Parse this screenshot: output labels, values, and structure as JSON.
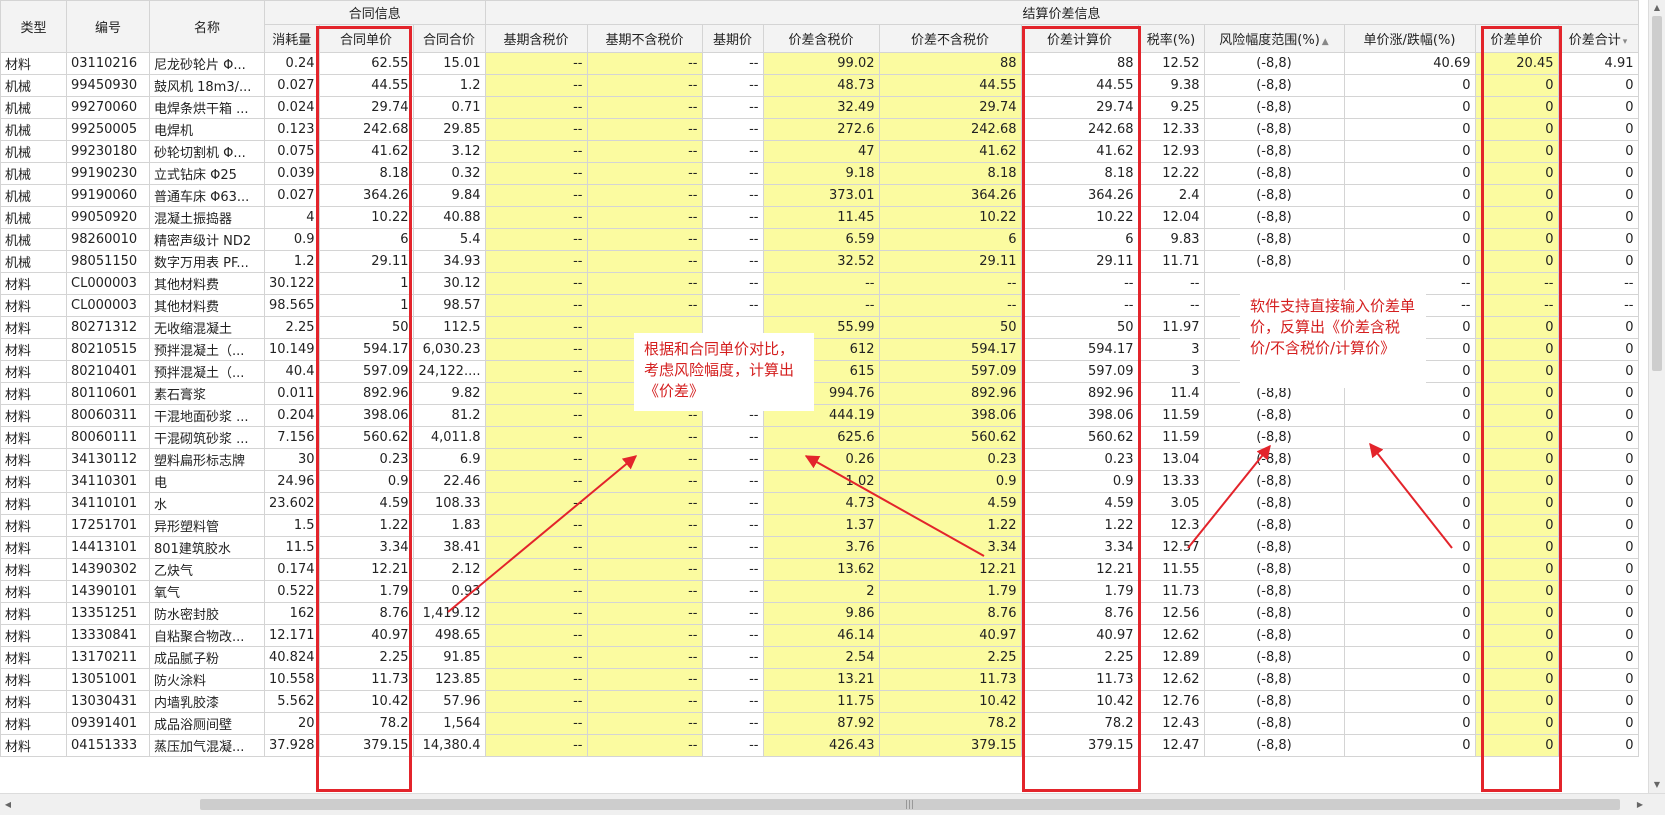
{
  "groups": {
    "contract": "合同信息",
    "settle": "结算价差信息"
  },
  "columns": [
    "类型",
    "编号",
    "名称",
    "消耗量",
    "合同单价",
    "合同合价",
    "基期含税价",
    "基期不含税价",
    "基期价",
    "价差含税价",
    "价差不含税价",
    "价差计算价",
    "税率(%)",
    "风险幅度范围(%)",
    "单价涨/跌幅(%)",
    "价差单价",
    "价差合计"
  ],
  "sort_icons": {
    "risk": "▲",
    "total": "▾"
  },
  "rows": [
    [
      "材料",
      "03110216",
      "尼龙砂轮片 Φ...",
      "0.24",
      "62.55",
      "15.01",
      "--",
      "--",
      "--",
      "99.02",
      "88",
      "88",
      "12.52",
      "(-8,8)",
      "40.69",
      "20.45",
      "4.91"
    ],
    [
      "机械",
      "99450930",
      "鼓风机 18m3/...",
      "0.027",
      "44.55",
      "1.2",
      "--",
      "--",
      "--",
      "48.73",
      "44.55",
      "44.55",
      "9.38",
      "(-8,8)",
      "0",
      "0",
      "0"
    ],
    [
      "机械",
      "99270060",
      "电焊条烘干箱 ...",
      "0.024",
      "29.74",
      "0.71",
      "--",
      "--",
      "--",
      "32.49",
      "29.74",
      "29.74",
      "9.25",
      "(-8,8)",
      "0",
      "0",
      "0"
    ],
    [
      "机械",
      "99250005",
      "电焊机",
      "0.123",
      "242.68",
      "29.85",
      "--",
      "--",
      "--",
      "272.6",
      "242.68",
      "242.68",
      "12.33",
      "(-8,8)",
      "0",
      "0",
      "0"
    ],
    [
      "机械",
      "99230180",
      "砂轮切割机 Φ...",
      "0.075",
      "41.62",
      "3.12",
      "--",
      "--",
      "--",
      "47",
      "41.62",
      "41.62",
      "12.93",
      "(-8,8)",
      "0",
      "0",
      "0"
    ],
    [
      "机械",
      "99190230",
      "立式钻床 Φ25",
      "0.039",
      "8.18",
      "0.32",
      "--",
      "--",
      "--",
      "9.18",
      "8.18",
      "8.18",
      "12.22",
      "(-8,8)",
      "0",
      "0",
      "0"
    ],
    [
      "机械",
      "99190060",
      "普通车床 Φ63...",
      "0.027",
      "364.26",
      "9.84",
      "--",
      "--",
      "--",
      "373.01",
      "364.26",
      "364.26",
      "2.4",
      "(-8,8)",
      "0",
      "0",
      "0"
    ],
    [
      "机械",
      "99050920",
      "混凝土振捣器",
      "4",
      "10.22",
      "40.88",
      "--",
      "--",
      "--",
      "11.45",
      "10.22",
      "10.22",
      "12.04",
      "(-8,8)",
      "0",
      "0",
      "0"
    ],
    [
      "机械",
      "98260010",
      "精密声级计 ND2",
      "0.9",
      "6",
      "5.4",
      "--",
      "--",
      "--",
      "6.59",
      "6",
      "6",
      "9.83",
      "(-8,8)",
      "0",
      "0",
      "0"
    ],
    [
      "机械",
      "98051150",
      "数字万用表 PF...",
      "1.2",
      "29.11",
      "34.93",
      "--",
      "--",
      "--",
      "32.52",
      "29.11",
      "29.11",
      "11.71",
      "(-8,8)",
      "0",
      "0",
      "0"
    ],
    [
      "材料",
      "CL000003",
      "其他材料费",
      "30.122",
      "1",
      "30.12",
      "--",
      "--",
      "--",
      "--",
      "--",
      "--",
      "--",
      "",
      "--",
      "--",
      "--"
    ],
    [
      "材料",
      "CL000003",
      "其他材料费",
      "98.565",
      "1",
      "98.57",
      "--",
      "--",
      "--",
      "--",
      "--",
      "--",
      "--",
      "",
      "--",
      "--",
      "--"
    ],
    [
      "材料",
      "80271312",
      "无收缩混凝土",
      "2.25",
      "50",
      "112.5",
      "--",
      "",
      "",
      "55.99",
      "50",
      "50",
      "11.97",
      "",
      "0",
      "0",
      "0"
    ],
    [
      "材料",
      "80210515",
      "预拌混凝土（...",
      "10.149",
      "594.17",
      "6,030.23",
      "--",
      "",
      "",
      "612",
      "594.17",
      "594.17",
      "3",
      "",
      "0",
      "0",
      "0"
    ],
    [
      "材料",
      "80210401",
      "预拌混凝土（...",
      "40.4",
      "597.09",
      "24,122....",
      "--",
      "",
      "",
      "615",
      "597.09",
      "597.09",
      "3",
      "",
      "0",
      "0",
      "0"
    ],
    [
      "材料",
      "80110601",
      "素石膏浆",
      "0.011",
      "892.96",
      "9.82",
      "--",
      "",
      "",
      "994.76",
      "892.96",
      "892.96",
      "11.4",
      "(-8,8)",
      "0",
      "0",
      "0"
    ],
    [
      "材料",
      "80060311",
      "干混地面砂浆 ...",
      "0.204",
      "398.06",
      "81.2",
      "--",
      "--",
      "--",
      "444.19",
      "398.06",
      "398.06",
      "11.59",
      "(-8,8)",
      "0",
      "0",
      "0"
    ],
    [
      "材料",
      "80060111",
      "干混砌筑砂浆 ...",
      "7.156",
      "560.62",
      "4,011.8",
      "--",
      "--",
      "--",
      "625.6",
      "560.62",
      "560.62",
      "11.59",
      "(-8,8)",
      "0",
      "0",
      "0"
    ],
    [
      "材料",
      "34130112",
      "塑料扁形标志牌",
      "30",
      "0.23",
      "6.9",
      "--",
      "--",
      "--",
      "0.26",
      "0.23",
      "0.23",
      "13.04",
      "(-8,8)",
      "0",
      "0",
      "0"
    ],
    [
      "材料",
      "34110301",
      "电",
      "24.96",
      "0.9",
      "22.46",
      "--",
      "--",
      "--",
      "1.02",
      "0.9",
      "0.9",
      "13.33",
      "(-8,8)",
      "0",
      "0",
      "0"
    ],
    [
      "材料",
      "34110101",
      "水",
      "23.602",
      "4.59",
      "108.33",
      "--",
      "--",
      "--",
      "4.73",
      "4.59",
      "4.59",
      "3.05",
      "(-8,8)",
      "0",
      "0",
      "0"
    ],
    [
      "材料",
      "17251701",
      "异形塑料管",
      "1.5",
      "1.22",
      "1.83",
      "--",
      "--",
      "--",
      "1.37",
      "1.22",
      "1.22",
      "12.3",
      "(-8,8)",
      "0",
      "0",
      "0"
    ],
    [
      "材料",
      "14413101",
      "801建筑胶水",
      "11.5",
      "3.34",
      "38.41",
      "--",
      "--",
      "--",
      "3.76",
      "3.34",
      "3.34",
      "12.57",
      "(-8,8)",
      "0",
      "0",
      "0"
    ],
    [
      "材料",
      "14390302",
      "乙炔气",
      "0.174",
      "12.21",
      "2.12",
      "--",
      "--",
      "--",
      "13.62",
      "12.21",
      "12.21",
      "11.55",
      "(-8,8)",
      "0",
      "0",
      "0"
    ],
    [
      "材料",
      "14390101",
      "氧气",
      "0.522",
      "1.79",
      "0.93",
      "--",
      "--",
      "--",
      "2",
      "1.79",
      "1.79",
      "11.73",
      "(-8,8)",
      "0",
      "0",
      "0"
    ],
    [
      "材料",
      "13351251",
      "防水密封胶",
      "162",
      "8.76",
      "1,419.12",
      "--",
      "--",
      "--",
      "9.86",
      "8.76",
      "8.76",
      "12.56",
      "(-8,8)",
      "0",
      "0",
      "0"
    ],
    [
      "材料",
      "13330841",
      "自粘聚合物改...",
      "12.171",
      "40.97",
      "498.65",
      "--",
      "--",
      "--",
      "46.14",
      "40.97",
      "40.97",
      "12.62",
      "(-8,8)",
      "0",
      "0",
      "0"
    ],
    [
      "材料",
      "13170211",
      "成品腻子粉",
      "40.824",
      "2.25",
      "91.85",
      "--",
      "--",
      "--",
      "2.54",
      "2.25",
      "2.25",
      "12.89",
      "(-8,8)",
      "0",
      "0",
      "0"
    ],
    [
      "材料",
      "13051001",
      "防火涂料",
      "10.558",
      "11.73",
      "123.85",
      "--",
      "--",
      "--",
      "13.21",
      "11.73",
      "11.73",
      "12.62",
      "(-8,8)",
      "0",
      "0",
      "0"
    ],
    [
      "材料",
      "13030431",
      "内墙乳胶漆",
      "5.562",
      "10.42",
      "57.96",
      "--",
      "--",
      "--",
      "11.75",
      "10.42",
      "10.42",
      "12.76",
      "(-8,8)",
      "0",
      "0",
      "0"
    ],
    [
      "材料",
      "09391401",
      "成品浴厕间壁",
      "20",
      "78.2",
      "1,564",
      "--",
      "--",
      "--",
      "87.92",
      "78.2",
      "78.2",
      "12.43",
      "(-8,8)",
      "0",
      "0",
      "0"
    ],
    [
      "材料",
      "04151333",
      "蒸压加气混凝...",
      "37.928",
      "379.15",
      "14,380.4",
      "--",
      "--",
      "--",
      "426.43",
      "379.15",
      "379.15",
      "12.47",
      "(-8,8)",
      "0",
      "0",
      "0"
    ]
  ],
  "annotations": {
    "note1": "根据和合同单价对比，考虑风险幅度，计算出《价差》",
    "note2": "软件支持直接输入价差单价，反算出《价差含税价/不含税价/计算价》"
  },
  "colors": {
    "highlight": "#e3242b",
    "yellow": "#fbfba0",
    "note_text": "#d41f1f"
  }
}
